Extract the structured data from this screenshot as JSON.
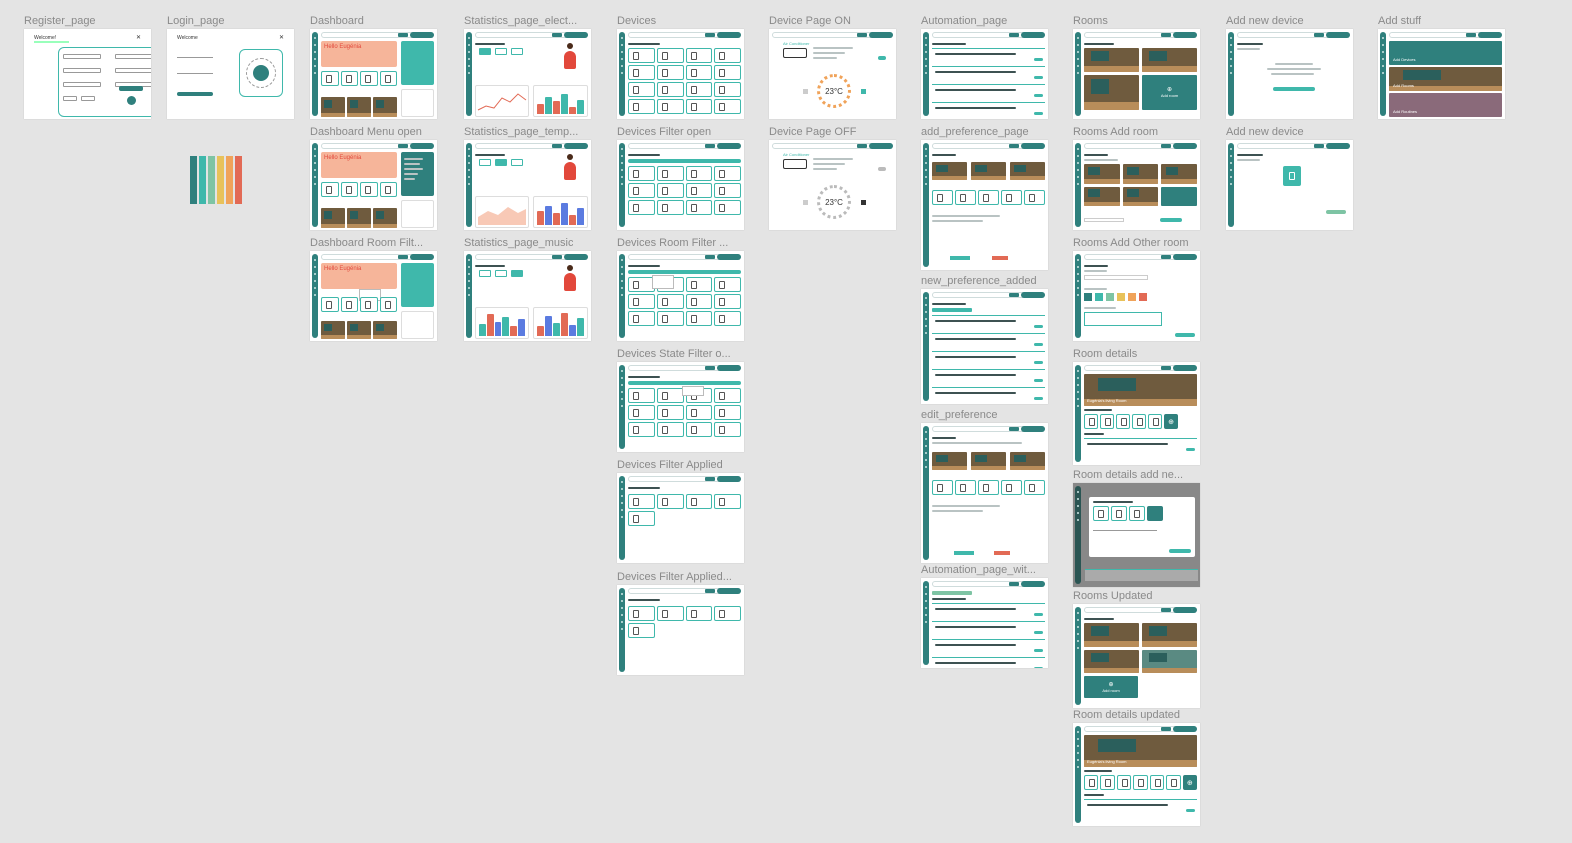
{
  "frames": {
    "register": "Register_page",
    "login": "Login_page",
    "dashboard": "Dashboard",
    "dashboard_menu_open": "Dashboard Menu open",
    "dashboard_room_filter": "Dashboard Room Filt...",
    "stats_elec": "Statistics_page_elect...",
    "stats_temp": "Statistics_page_temp...",
    "stats_music": "Statistics_page_music",
    "devices": "Devices",
    "devices_filter_open": "Devices Filter open",
    "devices_room_filter": "Devices Room Filter ...",
    "devices_state_filter": "Devices State Filter o...",
    "devices_filter_applied": "Devices Filter Applied",
    "devices_filter_applied2": "Devices Filter Applied...",
    "device_on": "Device Page ON",
    "device_off": "Device Page OFF",
    "automation": "Automation_page",
    "add_preference": "add_preference_page",
    "new_preference_added": "new_preference_added",
    "edit_preference": "edit_preference",
    "automation_with": "Automation_page_wit...",
    "rooms": "Rooms",
    "rooms_add_room": "Rooms Add room",
    "rooms_add_other": "Rooms Add Other room",
    "room_details": "Room details",
    "room_details_add": "Room details add ne...",
    "rooms_updated": "Rooms Updated",
    "room_details_updated": "Room details updated",
    "add_new_device": "Add new device",
    "add_new_device2": "Add new device",
    "add_stuff": "Add stuff"
  },
  "content": {
    "welcome": "Welcome!",
    "welcome2": "Welcome",
    "hello": "Hello Eugénia",
    "temp": "23°C",
    "air_conditioner": "Air Conditioner",
    "add_room": "Add room",
    "add_devices": "Add Devices",
    "add_rooms": "Add Rooms",
    "add_routines": "Add Routines",
    "living_room": "Eugénia's living Room",
    "devices_title": "Eugénia's Devices",
    "routines_title": "Eugénia's Routines",
    "rooms_title": "Eugénia's rooms",
    "statistics_title": "Eugénia's Statistics",
    "user": "Eugénia"
  },
  "palette": [
    "#2f807d",
    "#3fb8ab",
    "#7ec4a4",
    "#e8c25a",
    "#f0a35a",
    "#e26a55"
  ],
  "colors": {
    "primary": "#2f807d",
    "accent": "#3fb8ab",
    "peach": "#f6b59a",
    "coral": "#e26a55",
    "canvas": "#e4e4e4"
  }
}
